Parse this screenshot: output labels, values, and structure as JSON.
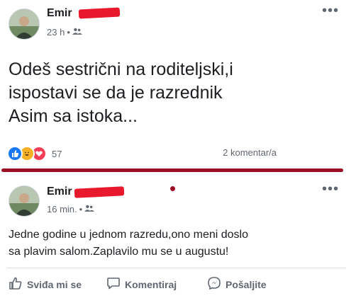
{
  "post1": {
    "author": "Emir",
    "time": "23 h",
    "text_lines": [
      "Odeš sestrični na roditeljski,i",
      "ispostavi se da je razrednik",
      "Asim sa istoka..."
    ],
    "reaction_count": "57",
    "comments": "2 komentar/a",
    "more": "•••"
  },
  "post2": {
    "author": "Emir",
    "time": "16 min.",
    "text_lines": [
      "Jedne godine u jednom razredu,ono meni doslo",
      "sa plavim salom.Zaplavilo mu se u augustu!"
    ],
    "more": "•••",
    "actions": {
      "like": "Sviđa mi se",
      "comment": "Komentiraj",
      "share": "Pošaljite"
    }
  },
  "meta_sep": "•",
  "colors": {
    "redaction": "#e8192c",
    "divider": "#9b0f24",
    "like": "#1877f2",
    "haha": "#f7b125",
    "love": "#f33e58"
  }
}
